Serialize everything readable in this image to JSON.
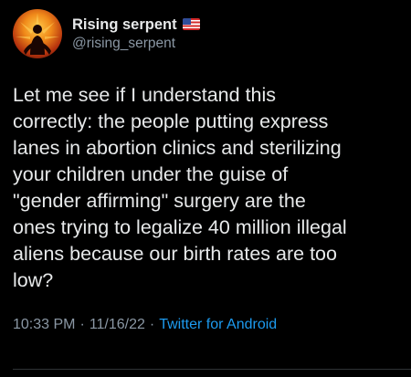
{
  "author": {
    "display_name": "Rising serpent",
    "handle": "@rising_serpent",
    "badge_icon": "us-flag-icon",
    "avatar_icon": "avatar-icon"
  },
  "tweet": {
    "lines": [
      "Let me see if I understand this",
      "correctly: the people putting express",
      "lanes in abortion clinics and sterilizing",
      "your children under the guise of",
      "\"gender affirming\" surgery are the",
      "ones trying to legalize 40 million illegal",
      "aliens because our birth rates are too",
      "low?"
    ],
    "time": "10:33 PM",
    "separator": "·",
    "date": "11/16/22",
    "source": "Twitter for Android"
  },
  "colors": {
    "background": "#000000",
    "text": "#e7e9ea",
    "secondary": "#8b98a5",
    "link": "#1d9bf0"
  }
}
